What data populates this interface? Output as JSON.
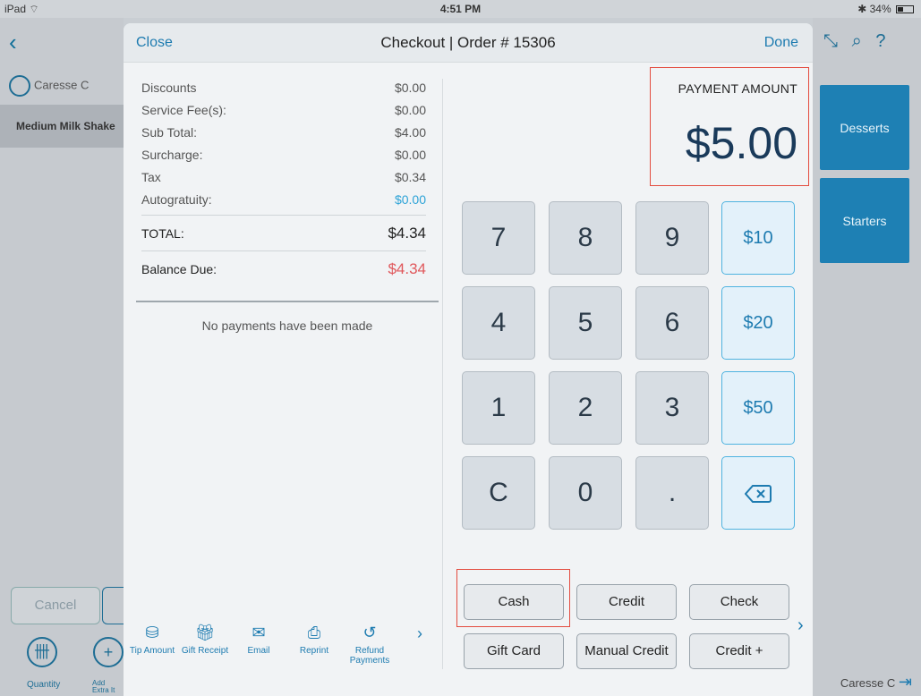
{
  "status": {
    "device": "iPad",
    "time": "4:51 PM",
    "battery": "34%"
  },
  "background": {
    "user": "Caresse C",
    "order_item": "Medium Milk Shake",
    "cancel": "Cancel",
    "quantity": "Quantity",
    "add_extra": "Add Extra It",
    "categories": [
      "Desserts",
      "Starters"
    ],
    "bottom_user": "Caresse C"
  },
  "modal": {
    "close": "Close",
    "title": "Checkout | Order # 15306",
    "done": "Done"
  },
  "summary": {
    "rows": [
      {
        "label": "Discounts",
        "value": "$0.00"
      },
      {
        "label": "Service Fee(s):",
        "value": "$0.00"
      },
      {
        "label": "Sub Total:",
        "value": "$4.00"
      },
      {
        "label": "Surcharge:",
        "value": "$0.00"
      },
      {
        "label": "Tax",
        "value": "$0.34"
      },
      {
        "label": "Autogratuity:",
        "value": "$0.00"
      }
    ],
    "total_label": "TOTAL:",
    "total_value": "$4.34",
    "balance_label": "Balance Due:",
    "balance_value": "$4.34",
    "no_payments": "No payments have been made"
  },
  "payment": {
    "label": "PAYMENT AMOUNT",
    "amount": "$5.00"
  },
  "keypad": {
    "keys": [
      "7",
      "8",
      "9",
      "4",
      "5",
      "6",
      "1",
      "2",
      "3",
      "C",
      "0",
      "."
    ],
    "quick": [
      "$10",
      "$20",
      "$50"
    ]
  },
  "methods": {
    "row1": [
      "Cash",
      "Credit",
      "Check"
    ],
    "row2": [
      "Gift Card",
      "Manual Credit",
      "Credit +"
    ]
  },
  "tools": [
    {
      "label": "Tip Amount",
      "icon": "coins-icon"
    },
    {
      "label": "Gift Receipt",
      "icon": "gift-icon"
    },
    {
      "label": "Email",
      "icon": "email-icon"
    },
    {
      "label": "Reprint",
      "icon": "printer-icon"
    },
    {
      "label": "Refund Payments",
      "icon": "refund-icon"
    }
  ],
  "colors": {
    "accent": "#1d7bb0",
    "highlight_box": "#e34c3f",
    "balance_due": "#e0575b",
    "category_tile": "#1e80b4"
  }
}
